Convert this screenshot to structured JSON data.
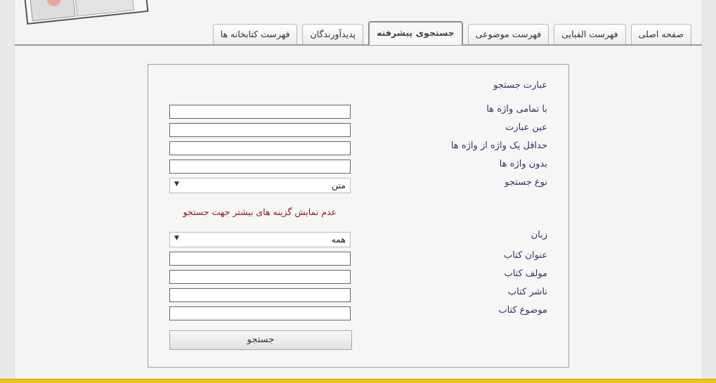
{
  "tabs": [
    {
      "label": "صفحه اصلی"
    },
    {
      "label": "فهرست الفبایی"
    },
    {
      "label": "فهرست موضوعی"
    },
    {
      "label": "جستجوی پیشرفته"
    },
    {
      "label": "پدیدآورندگان"
    },
    {
      "label": "فهرست کتابخانه ها"
    }
  ],
  "form": {
    "section_title": "عبارت جستجو",
    "all_words_label": "با تمامی واژه ها",
    "exact_phrase_label": "عین عبارت",
    "any_word_label": "حداقل یک واژه از واژه ها",
    "without_words_label": "بدون واژه ها",
    "search_type_label": "نوع جستجو",
    "search_type_value": "متن",
    "toggle_options_link": "عدم نمایش گزینه های بیشتر جهت جستجو",
    "language_label": "زبان",
    "language_value": "همه",
    "book_title_label": "عنوان کتاب",
    "book_author_label": "مولف کتاب",
    "book_publisher_label": "ناشر کتاب",
    "book_subject_label": "موضوع کتاب",
    "submit_label": "جستجو"
  },
  "icons": {
    "dropdown": "▼"
  },
  "colors": {
    "accent_bar": "#f2c21b",
    "label_text": "#343464",
    "link_text": "#8a1a1a"
  }
}
